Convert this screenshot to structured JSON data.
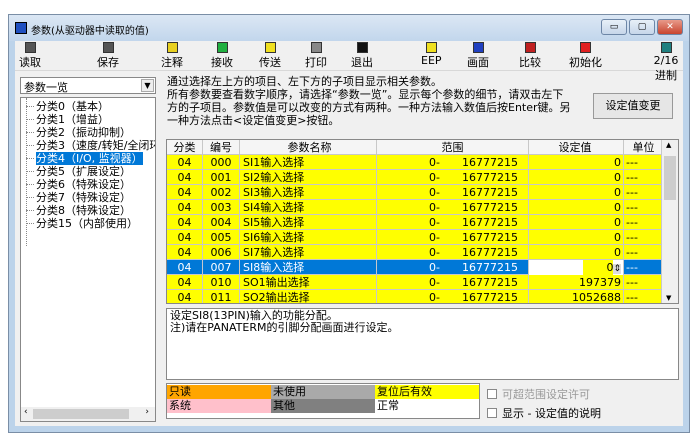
{
  "window": {
    "title": "参数(从驱动器中读取的值)",
    "controls": [
      "▭",
      "▢",
      "✕"
    ]
  },
  "toolbar": [
    {
      "label": "读取",
      "icon": "floppy-icon",
      "color": "#555555"
    },
    {
      "label": "保存",
      "icon": "floppy-icon",
      "color": "#555555"
    },
    {
      "label": "注释",
      "icon": "note-icon",
      "color": "#e8d020"
    },
    {
      "label": "接收",
      "icon": "receive-icon",
      "color": "#20b040"
    },
    {
      "label": "传送",
      "icon": "send-icon",
      "color": "#f0e020"
    },
    {
      "label": "打印",
      "icon": "printer-icon",
      "color": "#888888"
    },
    {
      "label": "退出",
      "icon": "exit-icon",
      "color": "#111111"
    },
    {
      "label": "EEP",
      "icon": "eep-icon",
      "color": "#f0e020"
    },
    {
      "label": "画面",
      "icon": "camera-icon",
      "color": "#2040c0"
    },
    {
      "label": "比较",
      "icon": "compare-icon",
      "color": "#c02020"
    },
    {
      "label": "初始化",
      "icon": "init-icon",
      "color": "#e02020"
    },
    {
      "label": "2/16进制",
      "icon": "hex-icon",
      "color": "#208080"
    }
  ],
  "dropdown": {
    "value": "参数一览"
  },
  "tree": [
    "分类0（基本）",
    "分类1（增益）",
    "分类2（振动抑制）",
    "分类3（速度/转矩/全闭环",
    "分类4（I/O, 监视器）",
    "分类5（扩展设定）",
    "分类6（特殊设定）",
    "分类7（特殊设定）",
    "分类8（特殊设定）",
    "分类15（内部使用）"
  ],
  "tree_selected": 4,
  "info": [
    "通过选择左上方的项目、左下方的子项目显示相关参数。",
    "所有参数要查看数字顺序，请选择“参数一览”。显示每个参数的细节，请双击左下",
    "方的子项目。参数值是可以改变的方式有两种。一种方法输入数值后按Enter键。另",
    "一种方法点击<设定值变更>按钮。"
  ],
  "change_button": "设定值变更",
  "table": {
    "headers": [
      "分类",
      "编号",
      "参数名称",
      "范围",
      "设定值",
      "单位"
    ],
    "rows": [
      [
        "04",
        "000",
        "SI1输入选择",
        "0-",
        "16777215",
        "0",
        "---"
      ],
      [
        "04",
        "001",
        "SI2输入选择",
        "0-",
        "16777215",
        "0",
        "---"
      ],
      [
        "04",
        "002",
        "SI3输入选择",
        "0-",
        "16777215",
        "0",
        "---"
      ],
      [
        "04",
        "003",
        "SI4输入选择",
        "0-",
        "16777215",
        "0",
        "---"
      ],
      [
        "04",
        "004",
        "SI5输入选择",
        "0-",
        "16777215",
        "0",
        "---"
      ],
      [
        "04",
        "005",
        "SI6输入选择",
        "0-",
        "16777215",
        "0",
        "---"
      ],
      [
        "04",
        "006",
        "SI7输入选择",
        "0-",
        "16777215",
        "0",
        "---"
      ],
      [
        "04",
        "007",
        "SI8输入选择",
        "0-",
        "16777215",
        "0",
        "---"
      ],
      [
        "04",
        "010",
        "SO1输出选择",
        "0-",
        "16777215",
        "197379",
        "---"
      ],
      [
        "04",
        "011",
        "SO2输出选择",
        "0-",
        "16777215",
        "1052688",
        "---"
      ]
    ],
    "selected_row": 7
  },
  "description": [
    "设定SI8(13PIN)输入的功能分配。",
    "注)请在PANATERM的引脚分配画面进行设定。"
  ],
  "legend": [
    {
      "label": "只读",
      "color": "#ffa500"
    },
    {
      "label": "未使用",
      "color": "#a9a9a9"
    },
    {
      "label": "复位后有效",
      "color": "#ffff00"
    },
    {
      "label": "系统",
      "color": "#ffc0cb"
    },
    {
      "label": "其他",
      "color": "#808080"
    },
    {
      "label": "正常",
      "color": "#ffffff"
    }
  ],
  "checkboxes": [
    {
      "label": "可超范围设定许可",
      "checked": false,
      "disabled": true
    },
    {
      "label": "显示 - 设定值的说明",
      "checked": false,
      "disabled": false
    }
  ]
}
